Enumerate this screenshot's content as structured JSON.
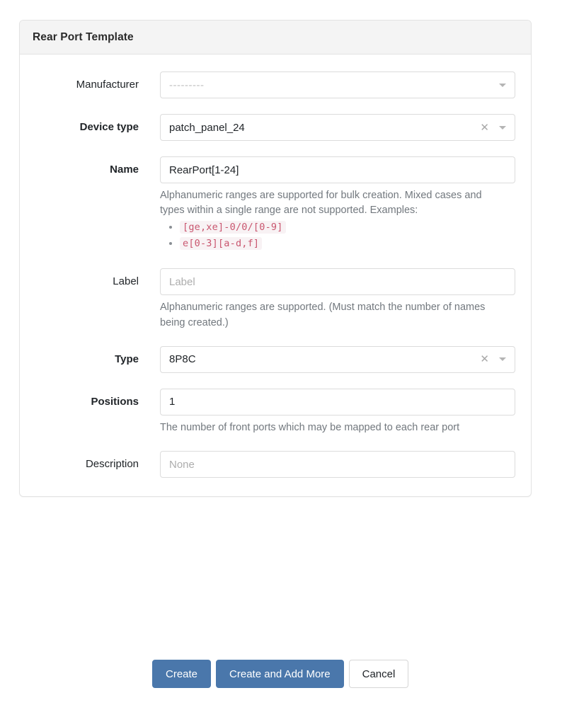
{
  "card": {
    "title": "Rear Port Template"
  },
  "form": {
    "manufacturer": {
      "label": "Manufacturer",
      "value": "---------",
      "required": false,
      "caret_icon": "chevron-down-icon"
    },
    "device_type": {
      "label": "Device type",
      "value": "patch_panel_24",
      "required": true,
      "clear_icon": "close-icon",
      "caret_icon": "chevron-down-icon"
    },
    "name": {
      "label": "Name",
      "value": "RearPort[1-24]",
      "required": true,
      "help_text": "Alphanumeric ranges are supported for bulk creation. Mixed cases and types within a single range are not supported. Examples:",
      "help_examples": [
        "[ge,xe]-0/0/[0-9]",
        "e[0-3][a-d,f]"
      ]
    },
    "label": {
      "label": "Label",
      "value": "",
      "placeholder": "Label",
      "required": false,
      "help_text": "Alphanumeric ranges are supported. (Must match the number of names being created.)"
    },
    "type": {
      "label": "Type",
      "value": "8P8C",
      "required": true,
      "clear_icon": "close-icon",
      "caret_icon": "chevron-down-icon"
    },
    "positions": {
      "label": "Positions",
      "value": "1",
      "required": true,
      "help_text": "The number of front ports which may be mapped to each rear port"
    },
    "description": {
      "label": "Description",
      "value": "",
      "placeholder": "None",
      "required": false
    }
  },
  "buttons": {
    "create": "Create",
    "create_and_add_more": "Create and Add More",
    "cancel": "Cancel"
  },
  "colors": {
    "primary": "#4a77ab",
    "code_text": "#c9566f",
    "code_bg": "#f8f2f4",
    "muted": "#72787e",
    "header_bg": "#f4f4f4",
    "border": "#dcdcdc"
  }
}
